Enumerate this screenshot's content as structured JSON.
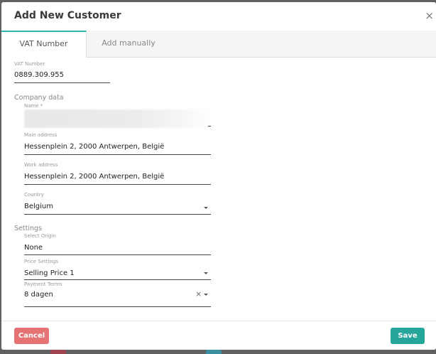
{
  "dialog": {
    "title": "Add New Customer",
    "close_glyph": "×"
  },
  "tabs": [
    {
      "label": "VAT Number",
      "active": true
    },
    {
      "label": "Add manually",
      "active": false
    }
  ],
  "vat": {
    "label": "VAT Number",
    "value": "0889.309.955"
  },
  "company": {
    "section_label": "Company data",
    "name_label": "Name *",
    "name_value": "",
    "main_address_label": "Main address",
    "main_address_value": "Hessenplein 2, 2000 Antwerpen, België",
    "work_address_label": "Work address",
    "work_address_value": "Hessenplein 2, 2000 Antwerpen, België",
    "country_label": "Country",
    "country_value": "Belgium"
  },
  "settings": {
    "section_label": "Settings",
    "origin_label": "Select Origin",
    "origin_value": "None",
    "price_label": "Price Settings",
    "price_value": "Selling Price 1",
    "payment_label": "Payment Terms",
    "payment_value": "8 dagen",
    "clear_glyph": "×"
  },
  "footer": {
    "cancel_label": "Cancel",
    "save_label": "Save"
  },
  "colors": {
    "accent": "#26a69a",
    "danger": "#e57373",
    "tab_indicator": "#2bb3ad"
  }
}
